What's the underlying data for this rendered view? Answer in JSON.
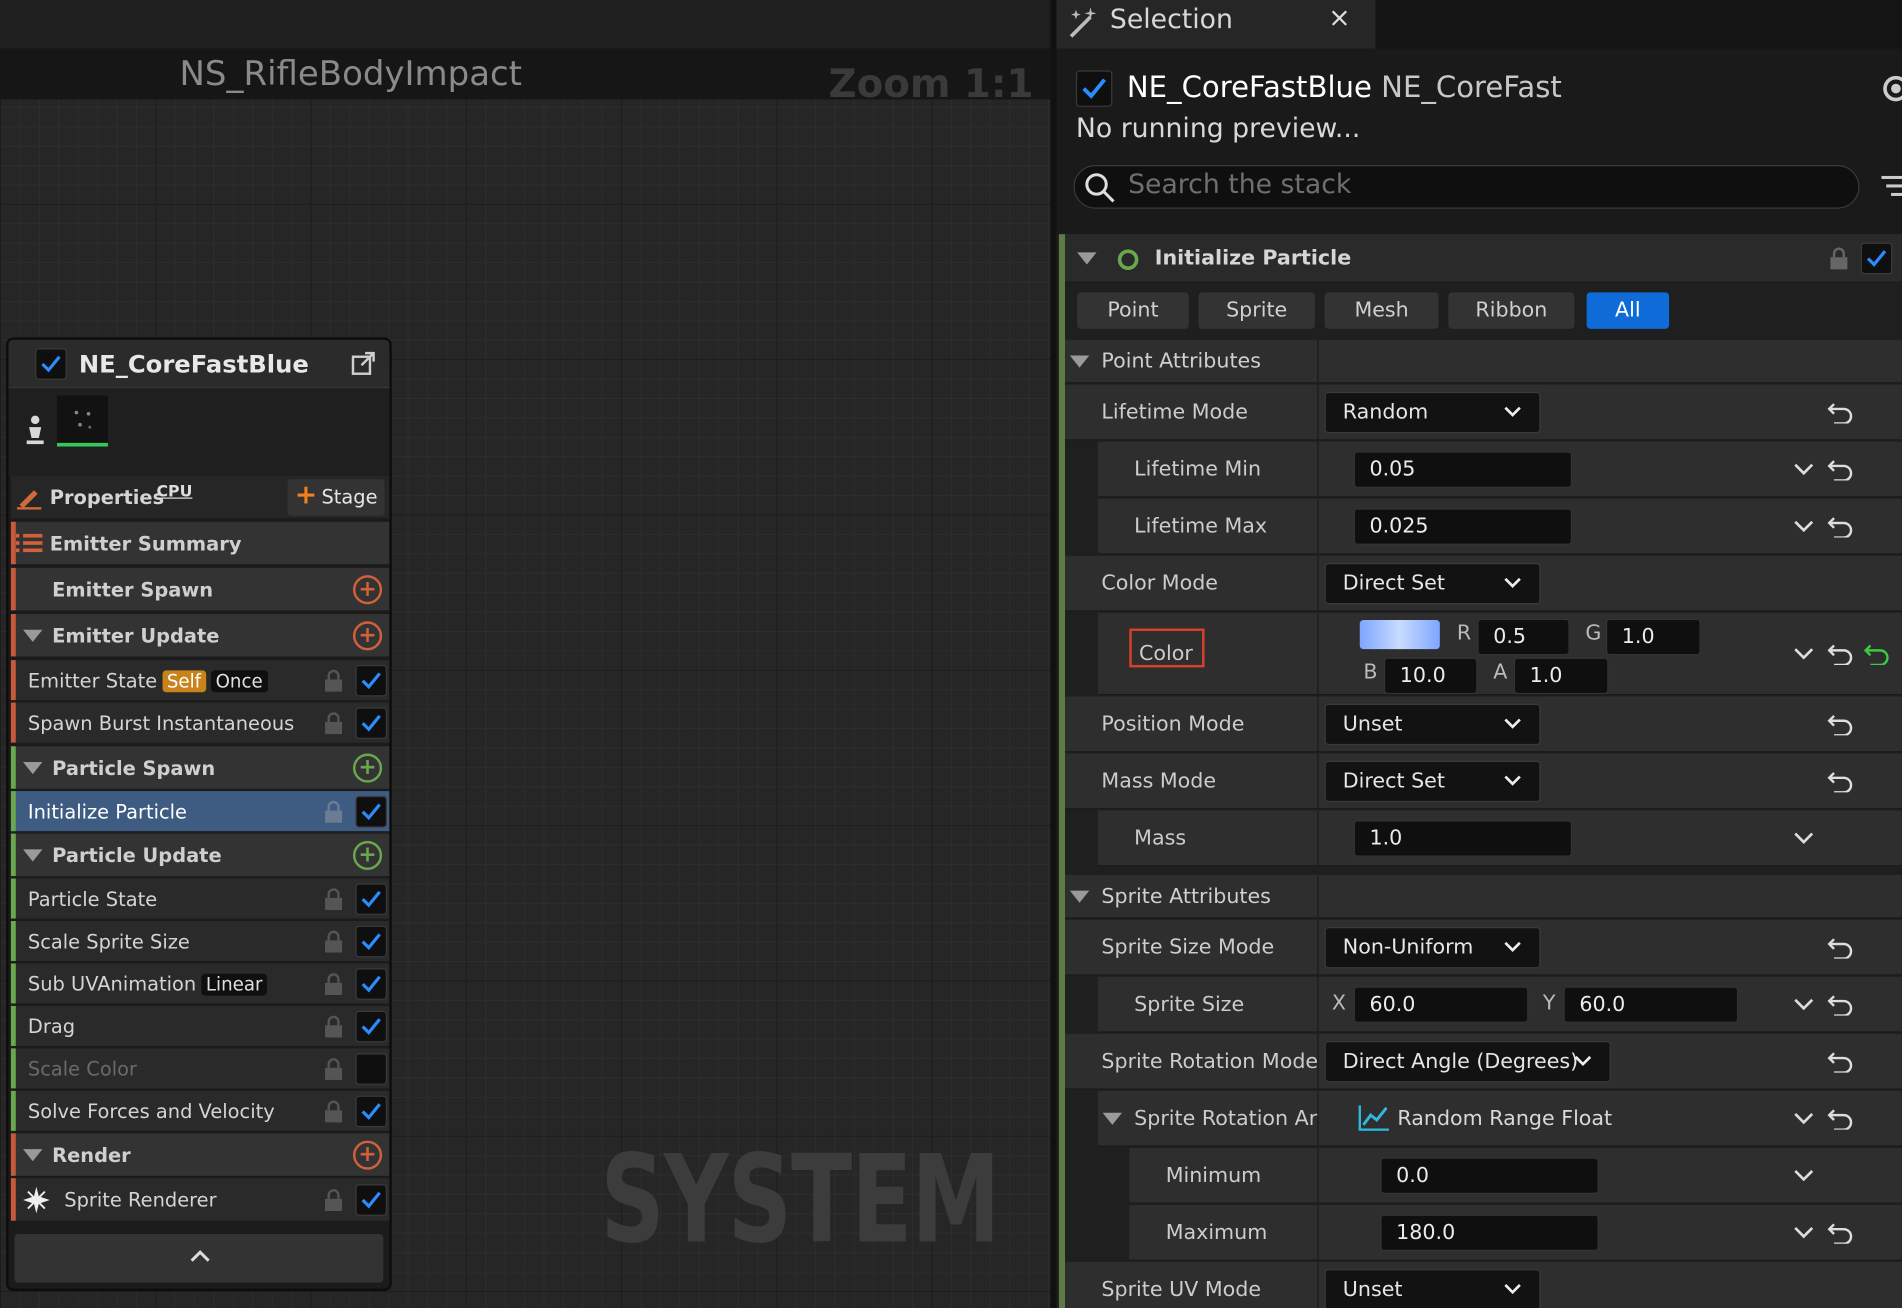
{
  "graph": {
    "title": "NS_RifleBodyImpact",
    "zoom": "Zoom 1:1",
    "watermark": "SYSTEM"
  },
  "node": {
    "name": "NE_CoreFastBlue",
    "properties_label": "Properties",
    "cpu_label": "CPU",
    "stage_label": "Stage",
    "rows": [
      {
        "label": "Emitter Summary"
      },
      {
        "label": "Emitter Spawn"
      },
      {
        "label": "Emitter Update"
      },
      {
        "label": "Emitter State",
        "tag1": "Self",
        "tag2": "Once"
      },
      {
        "label": "Spawn Burst Instantaneous"
      },
      {
        "label": "Particle Spawn"
      },
      {
        "label": "Initialize Particle"
      },
      {
        "label": "Particle Update"
      },
      {
        "label": "Particle State"
      },
      {
        "label": "Scale Sprite Size"
      },
      {
        "label": "Sub UVAnimation",
        "tag1": "Linear"
      },
      {
        "label": "Drag"
      },
      {
        "label": "Scale Color"
      },
      {
        "label": "Solve Forces and Velocity"
      },
      {
        "label": "Render"
      },
      {
        "label": "Sprite Renderer"
      }
    ]
  },
  "panel": {
    "tab_label": "Selection",
    "tab_close": "×",
    "emitter_name": "NE_CoreFastBlue",
    "emitter_parent": "NE_CoreFast",
    "status": "No running preview...",
    "search_placeholder": "Search the stack",
    "module_title": "Initialize Particle",
    "filters": [
      "Point",
      "Sprite",
      "Mesh",
      "Ribbon",
      "All"
    ],
    "point_section": "Point Attributes",
    "lifetime_mode": {
      "label": "Lifetime Mode",
      "value": "Random"
    },
    "lifetime_min": {
      "label": "Lifetime Min",
      "value": "0.05"
    },
    "lifetime_max": {
      "label": "Lifetime Max",
      "value": "0.025"
    },
    "color_mode": {
      "label": "Color Mode",
      "value": "Direct Set"
    },
    "color": {
      "label": "Color",
      "r_label": "R",
      "r": "0.5",
      "g_label": "G",
      "g": "1.0",
      "b_label": "B",
      "b": "10.0",
      "a_label": "A",
      "a": "1.0",
      "swatch": "#8fb4ff"
    },
    "position_mode": {
      "label": "Position Mode",
      "value": "Unset"
    },
    "mass_mode": {
      "label": "Mass Mode",
      "value": "Direct Set"
    },
    "mass": {
      "label": "Mass",
      "value": "1.0"
    },
    "sprite_section": "Sprite Attributes",
    "sprite_size_mode": {
      "label": "Sprite Size Mode",
      "value": "Non-Uniform"
    },
    "sprite_size": {
      "label": "Sprite Size",
      "x_label": "X",
      "x": "60.0",
      "y_label": "Y",
      "y": "60.0"
    },
    "sprite_rotation_mode": {
      "label": "Sprite Rotation Mode",
      "value": "Direct Angle (Degrees)"
    },
    "sprite_rotation_angle": {
      "label": "Sprite Rotation Ar",
      "value": "Random Range Float"
    },
    "minimum": {
      "label": "Minimum",
      "value": "0.0"
    },
    "maximum": {
      "label": "Maximum",
      "value": "180.0"
    },
    "sprite_uv_mode": {
      "label": "Sprite UV Mode",
      "value": "Unset"
    }
  },
  "colors": {
    "accent": "#0f6bd8",
    "selected_row": "#3e5c82",
    "stage_accent": "#f08020",
    "green": "#34c759",
    "module_bar": "#5e7a45"
  }
}
